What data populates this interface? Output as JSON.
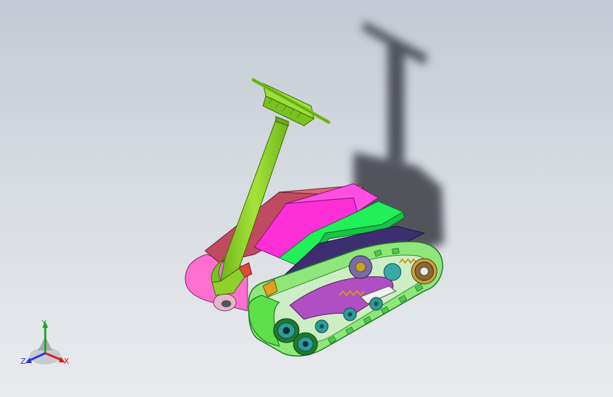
{
  "triad": {
    "x_label": "X",
    "y_label": "Y",
    "z_label": "Z",
    "x_color": "#d62020",
    "y_color": "#1fa31f",
    "z_color": "#2a36d8"
  },
  "colors": {
    "background_top": "#c3cad3",
    "background_bottom": "#e9ebee",
    "handle": "#8fd12b",
    "seat_magenta": "#ff2fd8",
    "seat_green": "#22f05a",
    "body_maroon": "#c04a5e",
    "track_green": "#5de04a",
    "pink_track": "#ff6fd0",
    "dark_panel": "#3d2f6f",
    "wheel_teal": "#2f9a9a"
  }
}
